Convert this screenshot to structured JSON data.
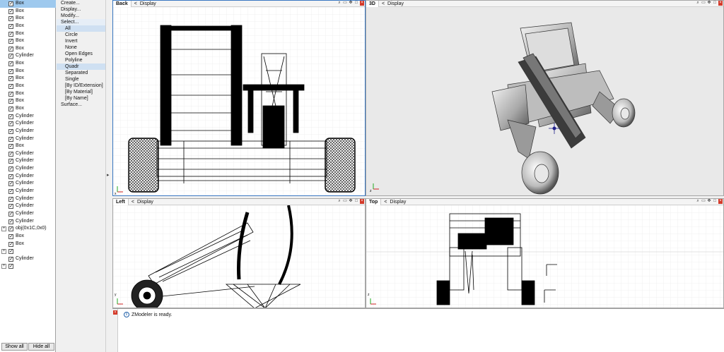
{
  "tree": {
    "items": [
      {
        "label": "Box",
        "selected": true
      },
      {
        "label": "Box"
      },
      {
        "label": "Box"
      },
      {
        "label": "Box"
      },
      {
        "label": "Box"
      },
      {
        "label": "Box"
      },
      {
        "label": "Box"
      },
      {
        "label": "Cylinder"
      },
      {
        "label": "Box"
      },
      {
        "label": "Box"
      },
      {
        "label": "Box"
      },
      {
        "label": "Box"
      },
      {
        "label": "Box"
      },
      {
        "label": "Box"
      },
      {
        "label": "Box"
      },
      {
        "label": "Cylinder"
      },
      {
        "label": "Cylinder"
      },
      {
        "label": "Cylinder"
      },
      {
        "label": "Cylinder"
      },
      {
        "label": "Box"
      },
      {
        "label": "Cylinder"
      },
      {
        "label": "Cylinder"
      },
      {
        "label": "Cylinder"
      },
      {
        "label": "Cylinder"
      },
      {
        "label": "Cylinder"
      },
      {
        "label": "Cylinder"
      },
      {
        "label": "Cylinder"
      },
      {
        "label": "Cylinder"
      },
      {
        "label": "Cylinder"
      },
      {
        "label": "Cylinder"
      },
      {
        "label": "obj(0x1C,0x0)",
        "expander": true
      },
      {
        "label": "Box"
      },
      {
        "label": "Box"
      },
      {
        "label": "",
        "expander": true
      },
      {
        "label": "Cylinder"
      },
      {
        "label": "",
        "expander": true
      }
    ],
    "show_all": "Show all",
    "hide_all": "Hide all"
  },
  "commands": [
    {
      "label": "Create...",
      "level": 0
    },
    {
      "label": "Display...",
      "level": 0
    },
    {
      "label": "Modify...",
      "level": 0
    },
    {
      "label": "Select...",
      "level": 0,
      "highlight": "hl2"
    },
    {
      "label": "All",
      "level": 1,
      "highlight": "hl"
    },
    {
      "label": "Circle",
      "level": 1
    },
    {
      "label": "Invert",
      "level": 1
    },
    {
      "label": "None",
      "level": 1
    },
    {
      "label": "Open Edges",
      "level": 1
    },
    {
      "label": "Polyline",
      "level": 1
    },
    {
      "label": "Quadr",
      "level": 1,
      "highlight": "hl"
    },
    {
      "label": "Separated",
      "level": 1
    },
    {
      "label": "Single",
      "level": 1
    },
    {
      "label": "[By ID/Extension]",
      "level": 1
    },
    {
      "label": "[By Material]",
      "level": 1
    },
    {
      "label": "[By Name]",
      "level": 1
    },
    {
      "label": "Surface...",
      "level": 0
    }
  ],
  "viewports": {
    "back": {
      "name": "Back",
      "menu": "Display"
    },
    "threed": {
      "name": "3D",
      "menu": "Display"
    },
    "left": {
      "name": "Left",
      "menu": "Display"
    },
    "top": {
      "name": "Top",
      "menu": "Display"
    }
  },
  "axes": {
    "x": "x",
    "y": "y",
    "z": "z"
  },
  "log": {
    "message": "ZModeler is ready."
  },
  "colors": {
    "selection": "#9ec9ee",
    "active_border": "#3a78c2",
    "axis_x": "#cc2222",
    "axis_y": "#22aa22",
    "close": "#d43a2a"
  }
}
